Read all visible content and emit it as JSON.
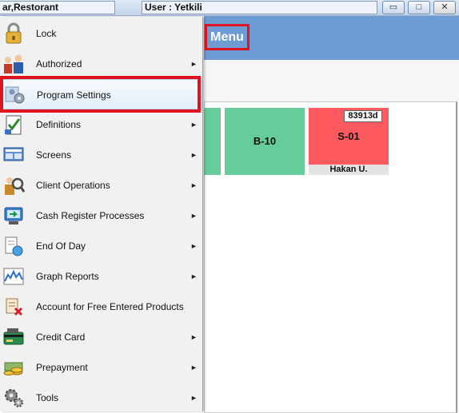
{
  "titlebar": {
    "app_title": "ar,Restorant",
    "user_text": "User : Yetkili",
    "minimize_glyph": "▭",
    "maximize_glyph": "□",
    "close_glyph": "✕"
  },
  "header": {
    "menu_label": "Menu"
  },
  "menu": {
    "items": [
      {
        "label": "Lock",
        "submenu": false,
        "icon": "padlock-icon"
      },
      {
        "label": "Authorized",
        "submenu": true,
        "icon": "users-icon"
      },
      {
        "label": "Program Settings",
        "submenu": false,
        "icon": "settings-people-icon",
        "highlighted": true
      },
      {
        "label": "Definitions",
        "submenu": true,
        "icon": "checklist-icon"
      },
      {
        "label": "Screens",
        "submenu": true,
        "icon": "screens-icon"
      },
      {
        "label": "Client Operations",
        "submenu": true,
        "icon": "client-search-icon"
      },
      {
        "label": "Cash Register Processes",
        "submenu": true,
        "icon": "cash-register-icon"
      },
      {
        "label": "End Of Day",
        "submenu": true,
        "icon": "end-of-day-icon"
      },
      {
        "label": "Graph Reports",
        "submenu": true,
        "icon": "graph-icon"
      },
      {
        "label": "Account for Free Entered Products",
        "submenu": false,
        "icon": "free-products-icon"
      },
      {
        "label": "Credit Card",
        "submenu": true,
        "icon": "credit-card-icon"
      },
      {
        "label": "Prepayment",
        "submenu": true,
        "icon": "coins-icon"
      },
      {
        "label": "Tools",
        "submenu": true,
        "icon": "gears-icon"
      }
    ],
    "arrow_glyph": "►"
  },
  "tables": [
    {
      "name": "B-10",
      "status_color": "#66cc99"
    },
    {
      "name": "S-01",
      "status_color": "#ff5a5f",
      "badge": "83913d",
      "waiter": "Hakan U."
    }
  ],
  "colors": {
    "header_band": "#6d9bd4",
    "highlight_frame": "#e0141e"
  }
}
